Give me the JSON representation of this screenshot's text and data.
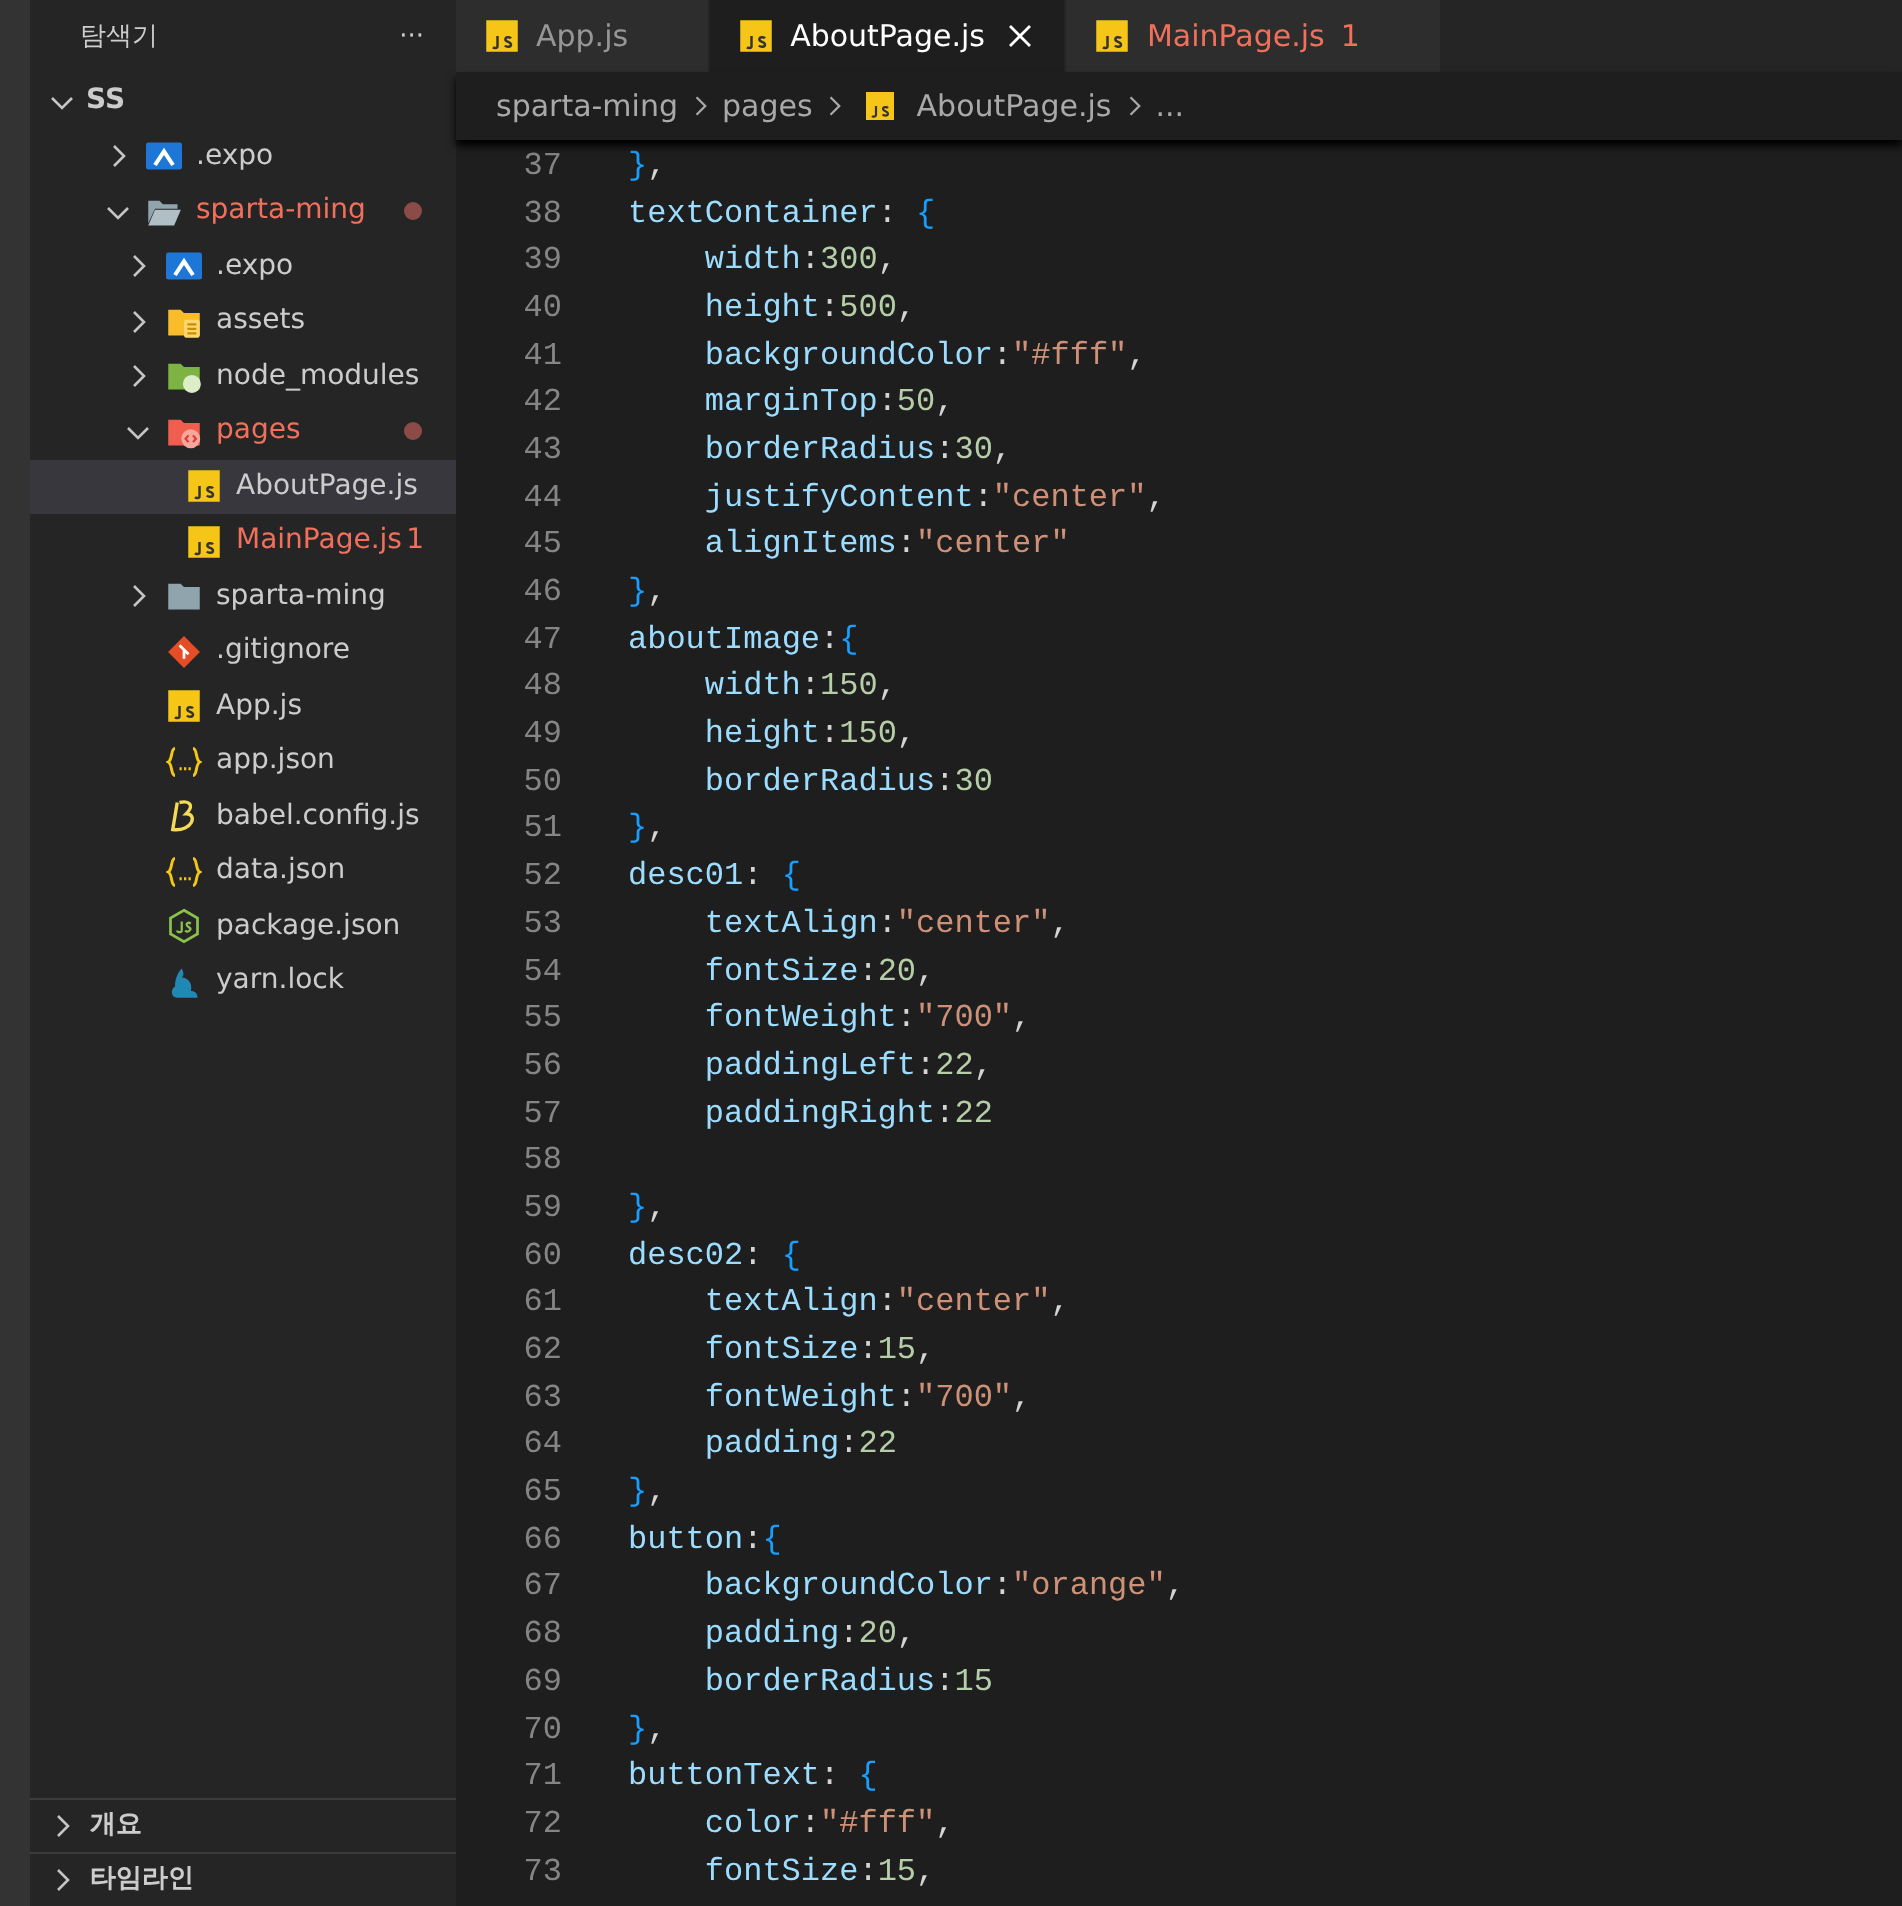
{
  "explorer": {
    "title": "탐색기",
    "more": "···",
    "tree": [
      {
        "label": "SS",
        "expanded": true,
        "selected": false,
        "children": [
          {
            "label": ".expo",
            "kind": "expo",
            "expanded": false,
            "selected": false,
            "problem": false,
            "dot": false
          },
          {
            "label": "sparta-ming",
            "kind": "folder-open",
            "expanded": true,
            "selected": false,
            "problem": true,
            "dot": true,
            "children": [
              {
                "label": ".expo",
                "kind": "expo",
                "expanded": false,
                "selected": false,
                "problem": false,
                "dot": false
              },
              {
                "label": "assets",
                "kind": "assets",
                "expanded": false,
                "selected": false,
                "problem": false,
                "dot": false
              },
              {
                "label": "node_modules",
                "kind": "node",
                "expanded": false,
                "selected": false,
                "problem": false,
                "dot": false
              },
              {
                "label": "pages",
                "kind": "pages",
                "expanded": true,
                "selected": false,
                "problem": true,
                "dot": true,
                "children": [
                  {
                    "label": "AboutPage.js",
                    "kind": "js",
                    "selected": true,
                    "problem": false,
                    "dot": false
                  },
                  {
                    "label": "MainPage.js",
                    "kind": "js",
                    "selected": false,
                    "problem": true,
                    "dot": false,
                    "badge": "1"
                  }
                ]
              },
              {
                "label": "sparta-ming",
                "kind": "folder",
                "expanded": false,
                "selected": false,
                "problem": false,
                "dot": false
              },
              {
                "label": ".gitignore",
                "kind": "git",
                "selected": false,
                "problem": false,
                "dot": false
              },
              {
                "label": "App.js",
                "kind": "js",
                "selected": false,
                "problem": false,
                "dot": false
              },
              {
                "label": "app.json",
                "kind": "json",
                "selected": false,
                "problem": false,
                "dot": false
              },
              {
                "label": "babel.config.js",
                "kind": "babel",
                "selected": false,
                "problem": false,
                "dot": false
              },
              {
                "label": "data.json",
                "kind": "json",
                "selected": false,
                "problem": false,
                "dot": false
              },
              {
                "label": "package.json",
                "kind": "nodejs",
                "selected": false,
                "problem": false,
                "dot": false
              },
              {
                "label": "yarn.lock",
                "kind": "yarn",
                "selected": false,
                "problem": false,
                "dot": false
              }
            ]
          }
        ]
      }
    ],
    "panels": [
      {
        "label": "개요",
        "expanded": false
      },
      {
        "label": "타임라인",
        "expanded": false
      }
    ]
  },
  "tabs": [
    {
      "label": "App.js",
      "selected": false,
      "problem": false
    },
    {
      "label": "AboutPage.js",
      "selected": true,
      "problem": false
    },
    {
      "label": "MainPage.js",
      "selected": false,
      "problem": true,
      "badge": "1"
    }
  ],
  "breadcrumb": [
    {
      "label": "sparta-ming",
      "kind": "segment"
    },
    {
      "label": "pages",
      "kind": "segment"
    },
    {
      "label": "AboutPage.js",
      "kind": "js"
    },
    {
      "label": "...",
      "kind": "segment"
    }
  ],
  "code": [
    {
      "number": "37",
      "tokens": [
        {
          "kind": "brace",
          "text": "}"
        },
        {
          "kind": "punct",
          "text": ","
        }
      ]
    },
    {
      "number": "38",
      "tokens": [
        {
          "kind": "key",
          "text": "textContainer"
        },
        {
          "kind": "punct",
          "text": ": "
        },
        {
          "kind": "brace",
          "text": "{"
        }
      ]
    },
    {
      "number": "39",
      "tokens": [
        {
          "kind": "key",
          "text": "width"
        },
        {
          "kind": "punct",
          "text": ":"
        },
        {
          "kind": "num",
          "text": "300"
        },
        {
          "kind": "punct",
          "text": ","
        }
      ]
    },
    {
      "number": "40",
      "tokens": [
        {
          "kind": "key",
          "text": "height"
        },
        {
          "kind": "punct",
          "text": ":"
        },
        {
          "kind": "num",
          "text": "500"
        },
        {
          "kind": "punct",
          "text": ","
        }
      ]
    },
    {
      "number": "41",
      "tokens": [
        {
          "kind": "key",
          "text": "backgroundColor"
        },
        {
          "kind": "punct",
          "text": ":"
        },
        {
          "kind": "str",
          "text": "\"#fff\""
        },
        {
          "kind": "punct",
          "text": ","
        }
      ]
    },
    {
      "number": "42",
      "tokens": [
        {
          "kind": "key",
          "text": "marginTop"
        },
        {
          "kind": "punct",
          "text": ":"
        },
        {
          "kind": "num",
          "text": "50"
        },
        {
          "kind": "punct",
          "text": ","
        }
      ]
    },
    {
      "number": "43",
      "tokens": [
        {
          "kind": "key",
          "text": "borderRadius"
        },
        {
          "kind": "punct",
          "text": ":"
        },
        {
          "kind": "num",
          "text": "30"
        },
        {
          "kind": "punct",
          "text": ","
        }
      ]
    },
    {
      "number": "44",
      "tokens": [
        {
          "kind": "key",
          "text": "justifyContent"
        },
        {
          "kind": "punct",
          "text": ":"
        },
        {
          "kind": "str",
          "text": "\"center\""
        },
        {
          "kind": "punct",
          "text": ","
        }
      ]
    },
    {
      "number": "45",
      "tokens": [
        {
          "kind": "key",
          "text": "alignItems"
        },
        {
          "kind": "punct",
          "text": ":"
        },
        {
          "kind": "str",
          "text": "\"center\""
        }
      ]
    },
    {
      "number": "46",
      "tokens": [
        {
          "kind": "brace",
          "text": "}"
        },
        {
          "kind": "punct",
          "text": ","
        }
      ]
    },
    {
      "number": "47",
      "tokens": [
        {
          "kind": "key",
          "text": "aboutImage"
        },
        {
          "kind": "punct",
          "text": ":"
        },
        {
          "kind": "brace",
          "text": "{"
        }
      ]
    },
    {
      "number": "48",
      "tokens": [
        {
          "kind": "key",
          "text": "width"
        },
        {
          "kind": "punct",
          "text": ":"
        },
        {
          "kind": "num",
          "text": "150"
        },
        {
          "kind": "punct",
          "text": ","
        }
      ]
    },
    {
      "number": "49",
      "tokens": [
        {
          "kind": "key",
          "text": "height"
        },
        {
          "kind": "punct",
          "text": ":"
        },
        {
          "kind": "num",
          "text": "150"
        },
        {
          "kind": "punct",
          "text": ","
        }
      ]
    },
    {
      "number": "50",
      "tokens": [
        {
          "kind": "key",
          "text": "borderRadius"
        },
        {
          "kind": "punct",
          "text": ":"
        },
        {
          "kind": "num",
          "text": "30"
        }
      ]
    },
    {
      "number": "51",
      "tokens": [
        {
          "kind": "brace",
          "text": "}"
        },
        {
          "kind": "punct",
          "text": ","
        }
      ]
    },
    {
      "number": "52",
      "tokens": [
        {
          "kind": "key",
          "text": "desc01"
        },
        {
          "kind": "punct",
          "text": ": "
        },
        {
          "kind": "brace",
          "text": "{"
        }
      ]
    },
    {
      "number": "53",
      "tokens": [
        {
          "kind": "key",
          "text": "textAlign"
        },
        {
          "kind": "punct",
          "text": ":"
        },
        {
          "kind": "str",
          "text": "\"center\""
        },
        {
          "kind": "punct",
          "text": ","
        }
      ]
    },
    {
      "number": "54",
      "tokens": [
        {
          "kind": "key",
          "text": "fontSize"
        },
        {
          "kind": "punct",
          "text": ":"
        },
        {
          "kind": "num",
          "text": "20"
        },
        {
          "kind": "punct",
          "text": ","
        }
      ]
    },
    {
      "number": "55",
      "tokens": [
        {
          "kind": "key",
          "text": "fontWeight"
        },
        {
          "kind": "punct",
          "text": ":"
        },
        {
          "kind": "str",
          "text": "\"700\""
        },
        {
          "kind": "punct",
          "text": ","
        }
      ]
    },
    {
      "number": "56",
      "tokens": [
        {
          "kind": "key",
          "text": "paddingLeft"
        },
        {
          "kind": "punct",
          "text": ":"
        },
        {
          "kind": "num",
          "text": "22"
        },
        {
          "kind": "punct",
          "text": ","
        }
      ]
    },
    {
      "number": "57",
      "tokens": [
        {
          "kind": "key",
          "text": "paddingRight"
        },
        {
          "kind": "punct",
          "text": ":"
        },
        {
          "kind": "num",
          "text": "22"
        }
      ]
    },
    {
      "number": "58"
    },
    {
      "number": "59",
      "tokens": [
        {
          "kind": "brace",
          "text": "}"
        },
        {
          "kind": "punct",
          "text": ","
        }
      ]
    },
    {
      "number": "60",
      "tokens": [
        {
          "kind": "key",
          "text": "desc02"
        },
        {
          "kind": "punct",
          "text": ": "
        },
        {
          "kind": "brace",
          "text": "{"
        }
      ]
    },
    {
      "number": "61",
      "tokens": [
        {
          "kind": "key",
          "text": "textAlign"
        },
        {
          "kind": "punct",
          "text": ":"
        },
        {
          "kind": "str",
          "text": "\"center\""
        },
        {
          "kind": "punct",
          "text": ","
        }
      ]
    },
    {
      "number": "62",
      "tokens": [
        {
          "kind": "key",
          "text": "fontSize"
        },
        {
          "kind": "punct",
          "text": ":"
        },
        {
          "kind": "num",
          "text": "15"
        },
        {
          "kind": "punct",
          "text": ","
        }
      ]
    },
    {
      "number": "63",
      "tokens": [
        {
          "kind": "key",
          "text": "fontWeight"
        },
        {
          "kind": "punct",
          "text": ":"
        },
        {
          "kind": "str",
          "text": "\"700\""
        },
        {
          "kind": "punct",
          "text": ","
        }
      ]
    },
    {
      "number": "64",
      "tokens": [
        {
          "kind": "key",
          "text": "padding"
        },
        {
          "kind": "punct",
          "text": ":"
        },
        {
          "kind": "num",
          "text": "22"
        }
      ]
    },
    {
      "number": "65",
      "tokens": [
        {
          "kind": "brace",
          "text": "}"
        },
        {
          "kind": "punct",
          "text": ","
        }
      ]
    },
    {
      "number": "66",
      "tokens": [
        {
          "kind": "key",
          "text": "button"
        },
        {
          "kind": "punct",
          "text": ":"
        },
        {
          "kind": "brace",
          "text": "{"
        }
      ]
    },
    {
      "number": "67",
      "tokens": [
        {
          "kind": "key",
          "text": "backgroundColor"
        },
        {
          "kind": "punct",
          "text": ":"
        },
        {
          "kind": "str",
          "text": "\"orange\""
        },
        {
          "kind": "punct",
          "text": ","
        }
      ]
    },
    {
      "number": "68",
      "tokens": [
        {
          "kind": "key",
          "text": "padding"
        },
        {
          "kind": "punct",
          "text": ":"
        },
        {
          "kind": "num",
          "text": "20"
        },
        {
          "kind": "punct",
          "text": ","
        }
      ]
    },
    {
      "number": "69",
      "tokens": [
        {
          "kind": "key",
          "text": "borderRadius"
        },
        {
          "kind": "punct",
          "text": ":"
        },
        {
          "kind": "num",
          "text": "15"
        }
      ]
    },
    {
      "number": "70",
      "tokens": [
        {
          "kind": "brace",
          "text": "}"
        },
        {
          "kind": "punct",
          "text": ","
        }
      ]
    },
    {
      "number": "71",
      "tokens": [
        {
          "kind": "key",
          "text": "buttonText"
        },
        {
          "kind": "punct",
          "text": ": "
        },
        {
          "kind": "brace",
          "text": "{"
        }
      ]
    },
    {
      "number": "72",
      "tokens": [
        {
          "kind": "key",
          "text": "color"
        },
        {
          "kind": "punct",
          "text": ":"
        },
        {
          "kind": "str",
          "text": "\"#fff\""
        },
        {
          "kind": "punct",
          "text": ","
        }
      ]
    },
    {
      "number": "73",
      "tokens": [
        {
          "kind": "key",
          "text": "fontSize"
        },
        {
          "kind": "punct",
          "text": ":"
        },
        {
          "kind": "num",
          "text": "15"
        },
        {
          "kind": "punct",
          "text": ","
        }
      ]
    }
  ]
}
